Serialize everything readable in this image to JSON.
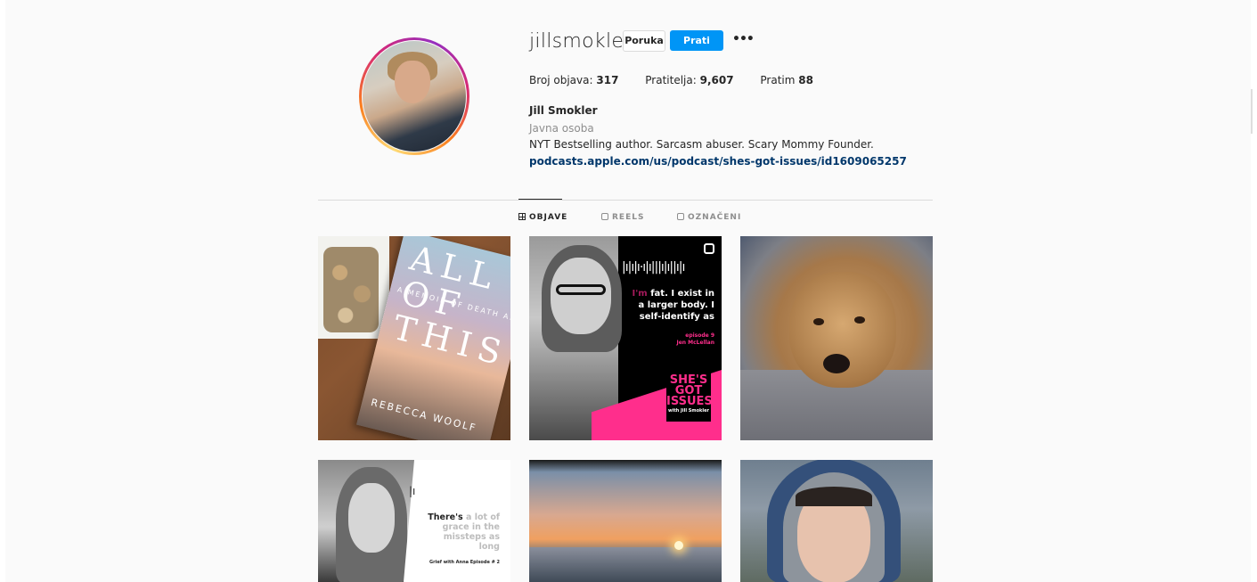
{
  "profile": {
    "username": "jillsmokler",
    "message_button": "Poruka",
    "follow_button": "Prati",
    "more": "•••",
    "stats": {
      "posts_label": "Broj objava:",
      "posts_value": "317",
      "followers_label": "Pratitelja:",
      "followers_value": "9,607",
      "following_label": "Pratim",
      "following_value": "88"
    },
    "full_name": "Jill Smokler",
    "category": "Javna osoba",
    "bio": "NYT Bestselling author. Sarcasm abuser. Scary Mommy Founder.",
    "link": "podcasts.apple.com/us/podcast/shes-got-issues/id1609065257"
  },
  "tabs": [
    {
      "label": "OBJAVE",
      "active": true,
      "icon": "grid-icon"
    },
    {
      "label": "REELS",
      "active": false,
      "icon": "reels-icon"
    },
    {
      "label": "OZNAČENI",
      "active": false,
      "icon": "tagged-icon"
    }
  ],
  "posts": {
    "p1": {
      "title": "ALL OF THIS",
      "subtitle": "A MEMOIR OF DEATH AND DESIRE",
      "author": "REBECCA WOOLF"
    },
    "p2": {
      "wave": "|ı|ı|ı·ı|ı|||ı|ı||ı|ı",
      "quote_pink": "I'm",
      "quote_white": "fat. I exist in a larger body. I self-identify as",
      "episode": "episode 9",
      "guest": "Jen McLellan",
      "logo_line1": "SHE'S",
      "logo_line2": "GOT",
      "logo_line3": "ISSUES",
      "logo_line4": "with Jill Smokler"
    },
    "p4": {
      "bars": "|ı",
      "quote_bold": "There's",
      "quote_rest": "a lot of grace in the missteps as long",
      "episode": "Grief with Anna Episode # 2"
    }
  },
  "colors": {
    "accent": "#0095f6",
    "link": "#00376b",
    "muted": "#8e8e8e",
    "pink": "#ff2e8c"
  }
}
